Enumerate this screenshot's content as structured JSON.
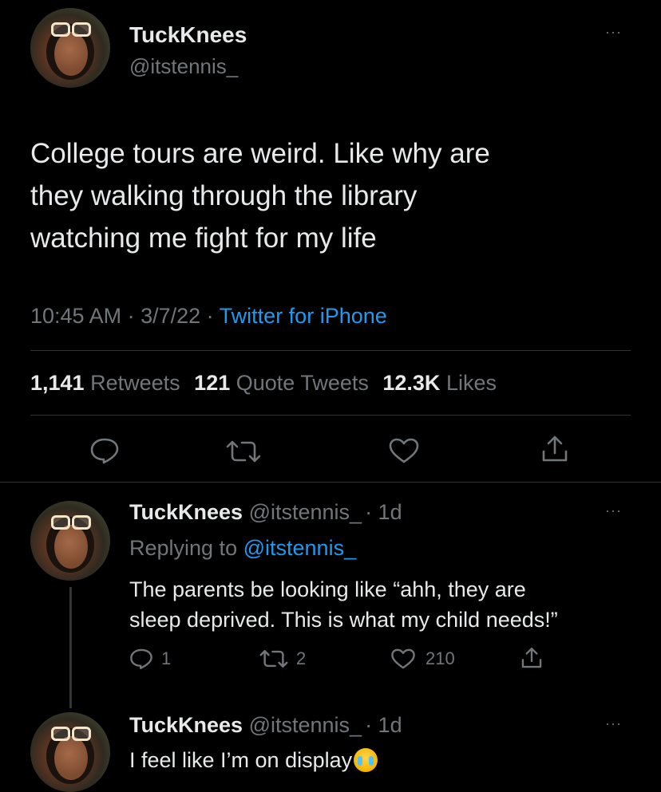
{
  "main_tweet": {
    "display_name": "TuckKnees",
    "handle": "@itstennis_",
    "text_lines": [
      "College tours are weird. Like why are",
      "they walking through the library",
      "watching me fight for my life"
    ],
    "time": "10:45 AM",
    "date": "3/7/22",
    "source": "Twitter for iPhone",
    "retweets_count": "1,141",
    "retweets_label": "Retweets",
    "quotes_count": "121",
    "quotes_label": "Quote Tweets",
    "likes_count": "12.3K",
    "likes_label": "Likes",
    "more": "···"
  },
  "reply1": {
    "display_name": "TuckKnees",
    "handle": "@itstennis_",
    "age": "· 1d",
    "replying_prefix": "Replying to",
    "replying_handle": "@itstennis_",
    "text_lines": [
      "The parents be looking like “ahh, they are",
      "sleep deprived. This is what my child needs!”"
    ],
    "reply_count": "1",
    "retweet_count": "2",
    "like_count": "210",
    "more": "···"
  },
  "reply2": {
    "display_name": "TuckKnees",
    "handle": "@itstennis_",
    "age": "· 1d",
    "text": "I feel like I’m on display",
    "emoji": "loudly-crying-face",
    "more": "···"
  },
  "colors": {
    "background": "#000000",
    "text": "#e7e9ea",
    "muted": "#71767b",
    "link": "#1d9bf0",
    "divider": "#2f3336"
  }
}
